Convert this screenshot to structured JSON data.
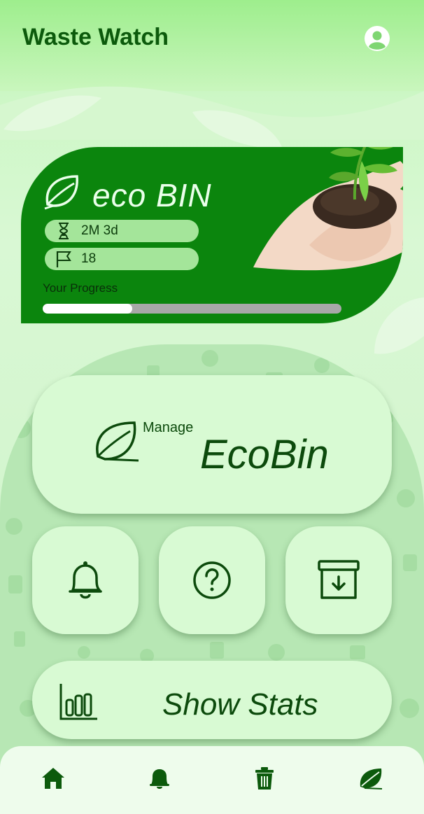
{
  "header": {
    "title": "Waste Watch",
    "profile_icon": "account-circle-icon"
  },
  "eco_card": {
    "title": "eco BIN",
    "duration": "2M 3d",
    "flag_count": "18",
    "progress_label": "Your Progress",
    "progress": 0.3
  },
  "actions": {
    "manage_small": "Manage",
    "manage_big": "EcoBin",
    "stats_label": "Show Stats",
    "icons": [
      "bell-icon",
      "help-circle-icon",
      "archive-download-icon"
    ]
  },
  "bottom_nav": [
    "home-icon",
    "bell-icon",
    "trash-icon",
    "leaf-icon"
  ],
  "colors": {
    "dark_green": "#0c5a0c",
    "card_green": "#0b850d",
    "tile": "#d8fad3"
  }
}
